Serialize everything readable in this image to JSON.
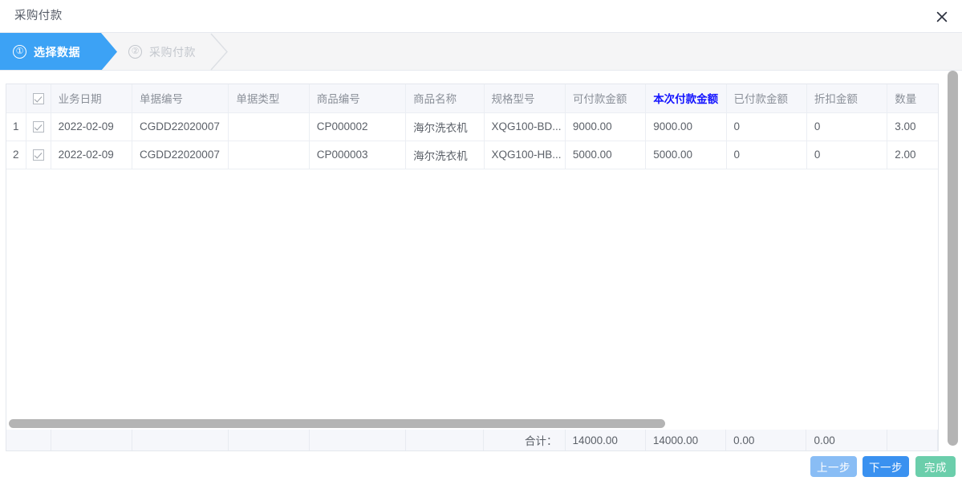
{
  "window": {
    "title": "采购付款",
    "close_icon": "close-icon"
  },
  "steps": [
    {
      "number": "①",
      "label": "选择数据",
      "state": "active"
    },
    {
      "number": "②",
      "label": "采购付款",
      "state": "inactive"
    }
  ],
  "table": {
    "columns": [
      {
        "key": "index",
        "label": ""
      },
      {
        "key": "check",
        "label": ""
      },
      {
        "key": "date",
        "label": "业务日期"
      },
      {
        "key": "docno",
        "label": "单据编号"
      },
      {
        "key": "doctype",
        "label": "单据类型"
      },
      {
        "key": "prodno",
        "label": "商品编号"
      },
      {
        "key": "prodname",
        "label": "商品名称"
      },
      {
        "key": "spec",
        "label": "规格型号"
      },
      {
        "key": "payable",
        "label": "可付款金额"
      },
      {
        "key": "thispay",
        "label": "本次付款金额",
        "highlight": true
      },
      {
        "key": "paid",
        "label": "已付款金额"
      },
      {
        "key": "discount",
        "label": "折扣金额"
      },
      {
        "key": "qty",
        "label": "数量"
      }
    ],
    "header_select_all": true,
    "rows": [
      {
        "index": "1",
        "checked": true,
        "date": "2022-02-09",
        "docno": "CGDD22020007",
        "doctype": "",
        "prodno": "CP000002",
        "prodname": "海尔洗衣机",
        "spec": "XQG100-BD...",
        "payable": "9000.00",
        "thispay": "9000.00",
        "paid": "0",
        "discount": "0",
        "qty": "3.00"
      },
      {
        "index": "2",
        "checked": true,
        "date": "2022-02-09",
        "docno": "CGDD22020007",
        "doctype": "",
        "prodno": "CP000003",
        "prodname": "海尔洗衣机",
        "spec": "XQG100-HB...",
        "payable": "5000.00",
        "thispay": "5000.00",
        "paid": "0",
        "discount": "0",
        "qty": "2.00"
      }
    ]
  },
  "totals": {
    "label": "合计：",
    "payable": "14000.00",
    "thispay": "14000.00",
    "paid": "0.00",
    "discount": "0.00",
    "qty": ""
  },
  "buttons": {
    "prev": "上一步",
    "next": "下一步",
    "done": "完成"
  },
  "colors": {
    "step_active": "#3ca2f5",
    "highlight_header": "#1414ff",
    "btn_prev": "#89bdf5",
    "btn_next": "#3a91f0",
    "btn_done": "#6bceab",
    "scrollbar": "#b4b4b4"
  }
}
